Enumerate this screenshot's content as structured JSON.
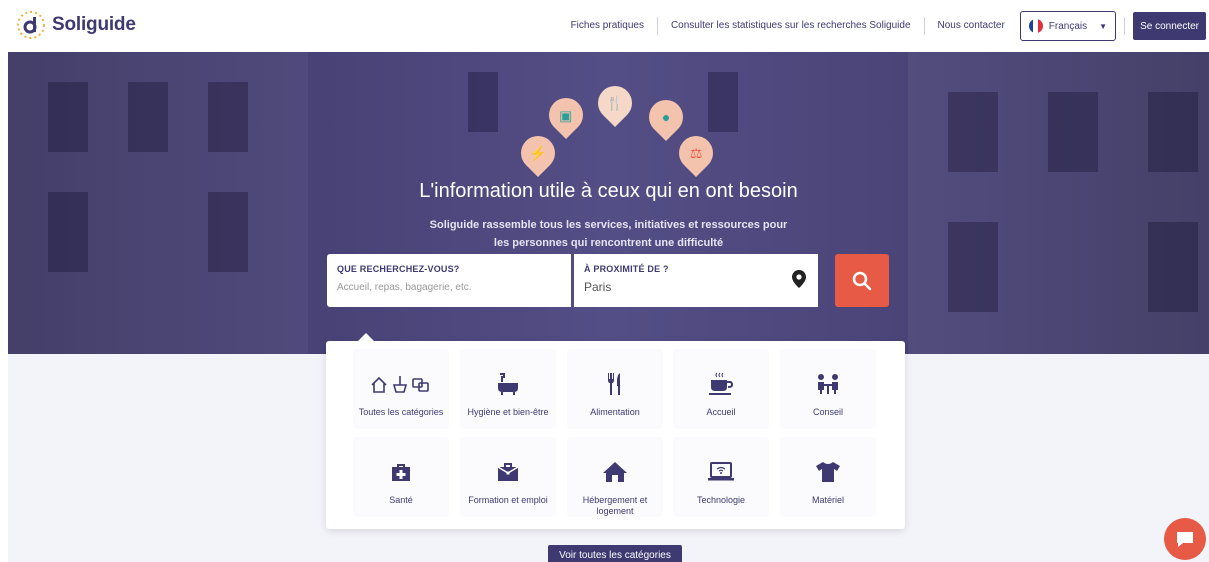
{
  "brand": {
    "name": "Soliguide"
  },
  "nav": {
    "links": [
      "Fiches pratiques",
      "Consulter les statistiques sur les recherches Soliguide",
      "Nous contacter"
    ],
    "language": "Français",
    "login": "Se connecter"
  },
  "hero": {
    "title": "L'information utile à ceux qui en ont besoin",
    "subtitle_line1": "Soliguide rassemble tous les services, initiatives et ressources pour",
    "subtitle_line2": "les personnes qui rencontrent une difficulté",
    "pins": [
      {
        "icon": "plug-icon",
        "color": "#f3c3ad"
      },
      {
        "icon": "briefcase-icon",
        "color": "#f3c3ad"
      },
      {
        "icon": "fork-knife-icon",
        "color": "#f5d8c8"
      },
      {
        "icon": "teapot-icon",
        "color": "#f3c3ad"
      },
      {
        "icon": "scales-icon",
        "color": "#f3c3ad"
      }
    ]
  },
  "search": {
    "what_label": "QUE RECHERCHEZ-VOUS?",
    "what_placeholder": "Accueil, repas, bagagerie, etc.",
    "where_label": "À PROXIMITÉ DE ?",
    "where_value": "Paris"
  },
  "categories": [
    {
      "label": "Toutes les catégories",
      "icon": "all-categories-icon"
    },
    {
      "label": "Hygiène et bien-être",
      "icon": "bathtub-icon"
    },
    {
      "label": "Alimentation",
      "icon": "fork-knife-icon"
    },
    {
      "label": "Accueil",
      "icon": "coffee-cup-icon"
    },
    {
      "label": "Conseil",
      "icon": "advice-table-icon"
    },
    {
      "label": "Santé",
      "icon": "medical-kit-icon"
    },
    {
      "label": "Formation et emploi",
      "icon": "briefcase-icon"
    },
    {
      "label": "Hébergement et logement",
      "icon": "house-icon"
    },
    {
      "label": "Technologie",
      "icon": "laptop-wifi-icon"
    },
    {
      "label": "Matériel",
      "icon": "tshirt-icon"
    }
  ],
  "all_categories_button": "Voir toutes les catégories",
  "colors": {
    "primary": "#3e3a71",
    "accent": "#e65a46",
    "background": "#f3f4fa"
  }
}
